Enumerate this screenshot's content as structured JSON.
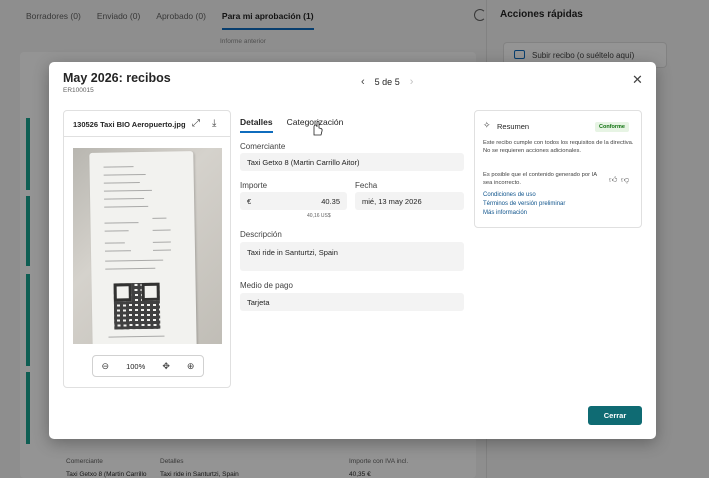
{
  "background": {
    "tabs": [
      "Borradores (0)",
      "Enviado (0)",
      "Aprobado (0)",
      "Para mi aprobación (1)"
    ],
    "quick_actions_title": "Acciones rápidas",
    "previous_report": "Informe anterior",
    "upload_receipt": "Subir recibo (o suéltelo aquí)",
    "footer_headers": [
      "Comerciante",
      "Detalles",
      "Importe con IVA incl."
    ],
    "footer_values": [
      "Taxi Getxo 8 (Martin Carrillo",
      "Taxi ride in Santurtzi, Spain",
      "40,35 €"
    ]
  },
  "dialog": {
    "title": "May 2026: recibos",
    "subtitle": "ER100015",
    "pager": "5 de 5",
    "close_label": "Cerrar"
  },
  "receipt": {
    "filename": "130526 Taxi BIO Aeropuerto.jpg",
    "zoom": "100%"
  },
  "tabs": [
    "Detalles",
    "Categorización"
  ],
  "fields": {
    "merchant_label": "Comerciante",
    "merchant_value": "Taxi Getxo 8 (Martin Carrillo Aitor)",
    "amount_label": "Importe",
    "currency": "€",
    "amount_value": "40.35",
    "amount_note": "40,16 US$",
    "date_label": "Fecha",
    "date_value": "mié, 13 may 2026",
    "description_label": "Descripción",
    "description_value": "Taxi ride in Santurtzi, Spain",
    "payment_label": "Medio de pago",
    "payment_value": "Tarjeta"
  },
  "summary": {
    "title": "Resumen",
    "badge": "Conforme",
    "text1": "Este recibo cumple con todos los requisitos de la directiva. No se requieren acciones adicionales.",
    "text2": "Es posible que el contenido generado por IA sea incorrecto.",
    "link1": "Condiciones de uso",
    "link2": "Términos de versión preliminar",
    "link3": "Más información"
  },
  "colors": {
    "primary_button": "#0f6b73",
    "accent": "#0f6cbd",
    "badge_green": "#0e700e"
  }
}
